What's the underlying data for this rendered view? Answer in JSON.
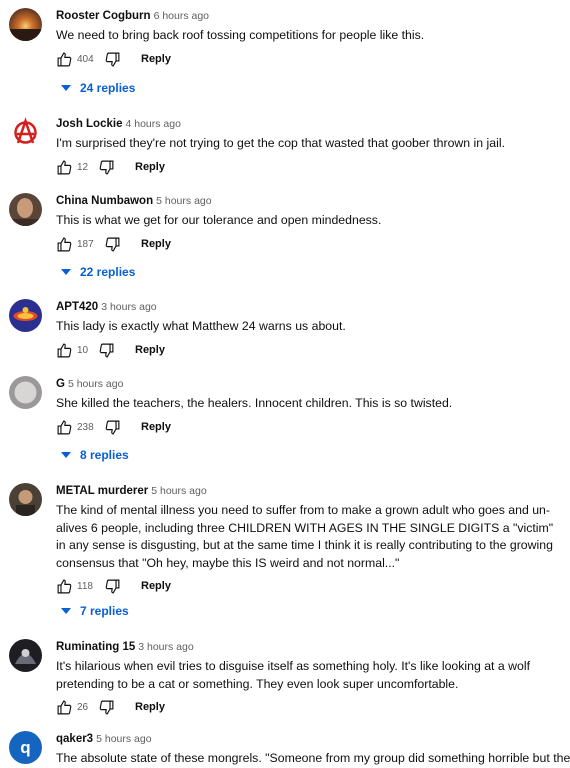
{
  "comments": [
    {
      "author": "Rooster Cogburn",
      "time": "6 hours ago",
      "text": "We need to bring back roof tossing competitions for people like this.",
      "likes": "404",
      "reply_label": "Reply",
      "replies_label": "24 replies"
    },
    {
      "author": "Josh Lockie",
      "time": "4 hours ago",
      "text": "I'm surprised they're not trying to get the cop that wasted that goober thrown in jail.",
      "likes": "12",
      "reply_label": "Reply",
      "replies_label": ""
    },
    {
      "author": "China Numbawon",
      "time": "5 hours ago",
      "text": "This is what we get for our tolerance and open mindedness.",
      "likes": "187",
      "reply_label": "Reply",
      "replies_label": "22 replies"
    },
    {
      "author": "APT420",
      "time": "3 hours ago",
      "text": "This lady is exactly what Matthew 24 warns us about.",
      "likes": "10",
      "reply_label": "Reply",
      "replies_label": ""
    },
    {
      "author": "G",
      "time": "5 hours ago",
      "text": "She killed the teachers, the healers. Innocent children. This is so twisted.",
      "likes": "238",
      "reply_label": "Reply",
      "replies_label": "8 replies"
    },
    {
      "author": "METAL murderer",
      "time": "5 hours ago",
      "text": "The kind of mental illness you need to suffer from to make a grown adult who goes and un-alives 6 people, including three CHILDREN WITH AGES IN THE SINGLE DIGITS a \"victim\" in any sense is disgusting, but at the same time I think it is really contributing to the growing consensus that \"Oh hey, maybe this IS weird and not normal...\"",
      "likes": "118",
      "reply_label": "Reply",
      "replies_label": "7 replies"
    },
    {
      "author": "Ruminating 15",
      "time": "3 hours ago",
      "text": "It's hilarious when evil tries to disguise itself as something holy. It's like looking at a wolf pretending to be a cat or something. They even look super uncomfortable.",
      "likes": "26",
      "reply_label": "Reply",
      "replies_label": ""
    },
    {
      "author": "qaker3",
      "time": "5 hours ago",
      "text": "The absolute state of these mongrels. \"Someone from my group did something horrible but they",
      "likes": "",
      "reply_label": "",
      "replies_label": "",
      "avatar_letter": "q"
    }
  ],
  "colors": {
    "link": "#065fd4",
    "secondary": "#606060",
    "avatar_q": "#1565c0"
  }
}
